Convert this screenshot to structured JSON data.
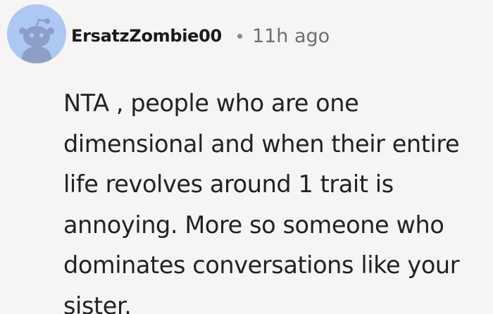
{
  "comment": {
    "author": "ErsatzZombie00",
    "timestamp": "11h ago",
    "avatar_icon": "reddit-snoo-icon",
    "body": "NTA , people who are one dimensional and when their entire life revolves around 1 trait is annoying. More so someone who dominates conversations like your sister."
  },
  "colors": {
    "background": "#f6f5f3",
    "avatar_bg": "#aec8f5",
    "avatar_figure": "#8d9fc8",
    "username": "#1a1a1a",
    "meta_gray": "#6f6f6f"
  }
}
